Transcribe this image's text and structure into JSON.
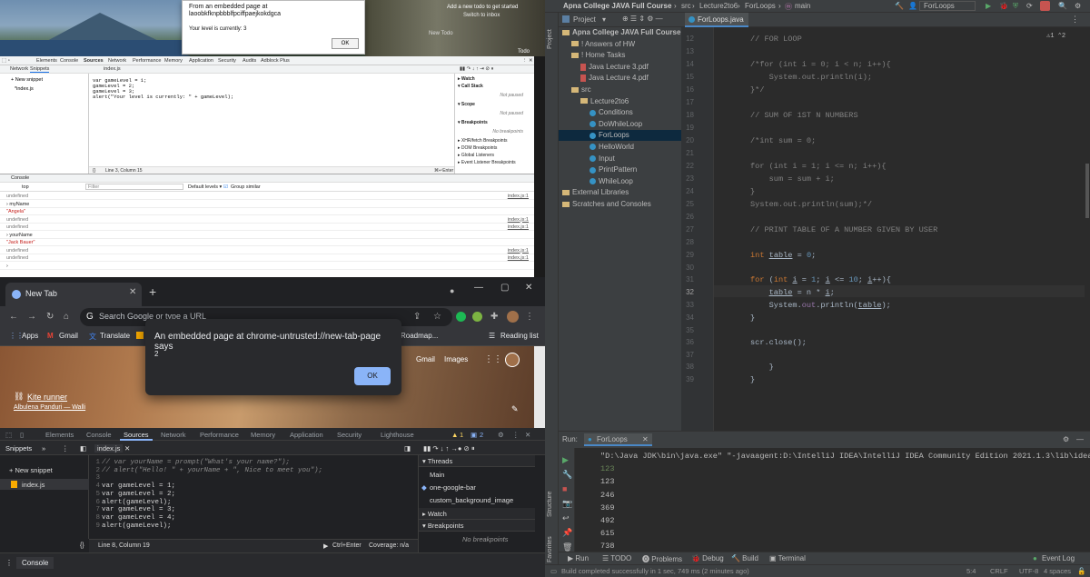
{
  "old_chrome": {
    "todo_title": "Add a new todo to get started",
    "todo_sub": "Switch to inbox",
    "new_todo": "New Todo",
    "todo_label": "Todo",
    "dialog_line1": "From an embedded page at",
    "dialog_line2": "laoobkfknpbbblfpciffpaejkokdgca",
    "dialog_line3": "Your level is currently: 3",
    "dialog_ok": "OK",
    "tabs": [
      "Elements",
      "Console",
      "Sources",
      "Network",
      "Performance",
      "Memory",
      "Application",
      "Security",
      "Audits",
      "Adblock Plus"
    ],
    "nav_tabs": [
      "Network",
      "Snippets"
    ],
    "file_tab": "index.js",
    "new_snippet": "+ New snippet",
    "snippet_file": "*index.js",
    "code": [
      "var gameLevel = 1;",
      "gameLevel = 2;",
      "gameLevel = 3;",
      "alert(\"Your level is currently: \" + gameLevel);"
    ],
    "status": "Line 3, Column 15",
    "run_hint": "⌘↵Enter",
    "debug": [
      {
        "title": "▸ Watch",
        "note": ""
      },
      {
        "title": "▾ Call Stack",
        "note": "Not paused"
      },
      {
        "title": "▾ Scope",
        "note": "Not paused"
      },
      {
        "title": "▾ Breakpoints",
        "note": "No breakpoints"
      },
      {
        "title": "▸ XHR/fetch Breakpoints",
        "note": ""
      },
      {
        "title": "▸ DOM Breakpoints",
        "note": ""
      },
      {
        "title": "▸ Global Listeners",
        "note": ""
      },
      {
        "title": "▸ Event Listener Breakpoints",
        "note": ""
      }
    ],
    "console_label": "Console",
    "console_context": "top",
    "console_filter": "Filter",
    "console_levels": "Default levels ▾",
    "console_group": "Group similar",
    "console_rows": [
      {
        "text": "undefined",
        "src": "index.js:1",
        "cls": "gray"
      },
      {
        "text": "› myName",
        "src": "",
        "cls": ""
      },
      {
        "text": "\"Angela\"",
        "src": "",
        "cls": "str"
      },
      {
        "text": "undefined",
        "src": "index.js:1",
        "cls": "gray"
      },
      {
        "text": "undefined",
        "src": "index.js:1",
        "cls": "gray"
      },
      {
        "text": "› yourName",
        "src": "",
        "cls": ""
      },
      {
        "text": "\"Jack Bauer\"",
        "src": "",
        "cls": "str"
      },
      {
        "text": "undefined",
        "src": "index.js:1",
        "cls": "gray"
      },
      {
        "text": "undefined",
        "src": "index.js:1",
        "cls": "gray"
      },
      {
        "text": "›",
        "src": "",
        "cls": ""
      }
    ]
  },
  "new_chrome": {
    "tab_title": "New Tab",
    "omnibox_placeholder": "Search Google or type a URL",
    "bookmarks": [
      "Apps",
      "Gmail",
      "Translate",
      "ear] Roadmap...",
      "Reading list"
    ],
    "gmail": "Gmail",
    "images": "Images",
    "kite": "Kite runner",
    "album": "Albulena Panduri — Walli",
    "dialog_title": "An embedded page at chrome-untrusted://new-tab-page says",
    "dialog_value": "2",
    "dialog_ok": "OK",
    "dt_tabs": [
      "Elements",
      "Console",
      "Sources",
      "Network",
      "Performance",
      "Memory",
      "Application",
      "Security",
      "Lighthouse"
    ],
    "warnings": "1",
    "issues": "2",
    "snippets_label": "Snippets",
    "file_tab": "index.js",
    "new_snippet": "+ New snippet",
    "snippet_file": "index.js",
    "code": [
      {
        "n": "1",
        "t": "// var yourName = prompt(\"What's your name?\");",
        "c": "cm"
      },
      {
        "n": "2",
        "t": "// alert(\"Hello! \" + yourName + \", Nice to meet you\");",
        "c": "cm"
      },
      {
        "n": "3",
        "t": "",
        "c": ""
      },
      {
        "n": "4",
        "t": "var gameLevel = 1;",
        "c": ""
      },
      {
        "n": "5",
        "t": "var gameLevel = 2;",
        "c": ""
      },
      {
        "n": "6",
        "t": "alert(gameLevel);",
        "c": ""
      },
      {
        "n": "7",
        "t": "var gameLevel = 3;",
        "c": ""
      },
      {
        "n": "8",
        "t": "var gameLevel = 4;",
        "c": ""
      },
      {
        "n": "9",
        "t": "alert(gameLevel);",
        "c": ""
      }
    ],
    "status_pos": "Line 8, Column 19",
    "run_hint": "Ctrl+Enter",
    "coverage": "Coverage: n/a",
    "threads": "Threads",
    "thread_items": [
      "Main",
      "one-google-bar",
      "custom_background_image"
    ],
    "watch": "Watch",
    "breakpoints": "Breakpoints",
    "no_breakpoints": "No breakpoints",
    "console": "Console"
  },
  "ide": {
    "breadcrumbs": [
      "Apna College JAVA Full Course",
      "src",
      "Lecture2to6",
      "ForLoops",
      "main"
    ],
    "run_config": "ForLoops",
    "project_label": "Project",
    "tree": [
      {
        "t": "Apna College JAVA Full Course",
        "d": 0,
        "i": "fold",
        "b": true
      },
      {
        "t": "! Answers of HW",
        "d": 1,
        "i": "fold"
      },
      {
        "t": "! Home Tasks",
        "d": 1,
        "i": "fold"
      },
      {
        "t": "Java Lecture 3.pdf",
        "d": 2,
        "i": "pdf"
      },
      {
        "t": "Java Lecture 4.pdf",
        "d": 2,
        "i": "pdf"
      },
      {
        "t": "src",
        "d": 1,
        "i": "fold"
      },
      {
        "t": "Lecture2to6",
        "d": 2,
        "i": "fold"
      },
      {
        "t": "Conditions",
        "d": 3,
        "i": "cls"
      },
      {
        "t": "DoWhileLoop",
        "d": 3,
        "i": "cls"
      },
      {
        "t": "ForLoops",
        "d": 3,
        "i": "cls",
        "sel": true
      },
      {
        "t": "HelloWorld",
        "d": 3,
        "i": "cls"
      },
      {
        "t": "Input",
        "d": 3,
        "i": "cls"
      },
      {
        "t": "PrintPattern",
        "d": 3,
        "i": "cls"
      },
      {
        "t": "WhileLoop",
        "d": 3,
        "i": "cls"
      },
      {
        "t": "External Libraries",
        "d": 0,
        "i": "fold"
      },
      {
        "t": "Scratches and Consoles",
        "d": 0,
        "i": "fold"
      }
    ],
    "editor_tab": "ForLoops.java",
    "warn_badge": "⚠1 ⌃2",
    "gutter_start": 12,
    "current_line": 32,
    "run_label": "Run:",
    "run_tab": "ForLoops",
    "run_output": [
      {
        "t": "\"D:\\Java JDK\\bin\\java.exe\" \"-javaagent:D:\\IntelliJ IDEA\\IntelliJ IDEA Community Edition 2021.1.3\\lib\\idea_rt",
        "c": ""
      },
      {
        "t": "123",
        "c": "in"
      },
      {
        "t": "123",
        "c": ""
      },
      {
        "t": "246",
        "c": ""
      },
      {
        "t": "369",
        "c": ""
      },
      {
        "t": "492",
        "c": ""
      },
      {
        "t": "615",
        "c": ""
      },
      {
        "t": "738",
        "c": ""
      }
    ],
    "bottom_tabs": [
      "▶ Run",
      "☰ TODO",
      "⓿ Problems",
      "🐞 Debug",
      "🔨 Build",
      "▣ Terminal"
    ],
    "event_log": "Event Log",
    "status_msg": "Build completed successfully in 1 sec, 749 ms (2 minutes ago)",
    "status_right": [
      "5:4",
      "CRLF",
      "UTF-8",
      "4 spaces"
    ],
    "side_labels": [
      "Project",
      "Structure",
      "Favorites"
    ]
  }
}
